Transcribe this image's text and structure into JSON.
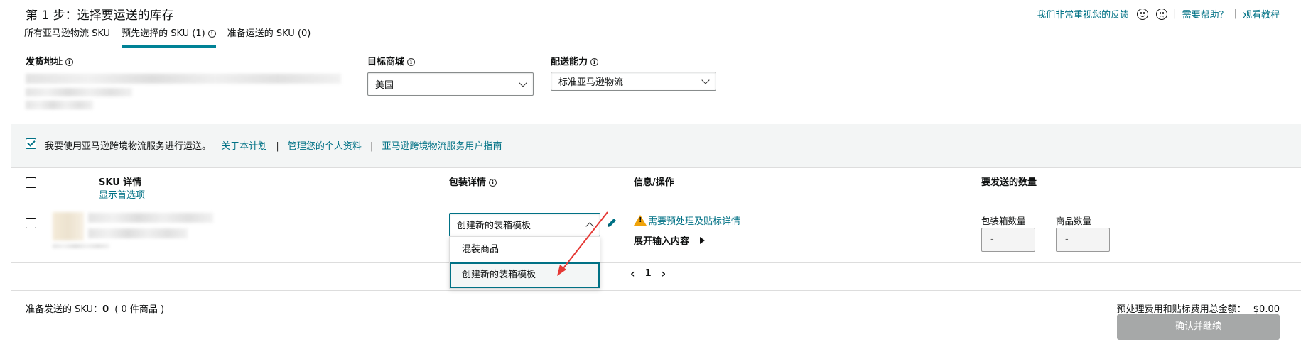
{
  "header": {
    "step_title": "第 1 步：选择要运送的库存",
    "feedback_link": "我们非常重视您的反馈",
    "help_link": "需要帮助？",
    "tutorial_link": "观看教程",
    "sep": "|"
  },
  "tabs": [
    {
      "label": "所有亚马逊物流 SKU",
      "active": false
    },
    {
      "label": "预先选择的 SKU (1)",
      "active": true
    },
    {
      "label": "准备运送的 SKU (0)",
      "active": false
    }
  ],
  "form": {
    "ship_from_label": "发货地址",
    "marketplace_label": "目标商城",
    "marketplace_value": "美国",
    "fulfillment_label": "配送能力",
    "fulfillment_value": "标准亚马逊物流"
  },
  "consent": {
    "text": "我要使用亚马逊跨境物流服务进行运送。",
    "checked": true,
    "links": [
      "关于本计划",
      "管理您的个人资料",
      "亚马逊跨境物流服务用户指南"
    ]
  },
  "table": {
    "headers": {
      "sku": "SKU 详情",
      "sku_sub": "显示首选项",
      "packing": "包装详情",
      "info": "信息/操作",
      "quantity": "要发送的数量"
    },
    "row": {
      "packing_value": "创建新的装箱模板",
      "warning_link": "需要预处理及贴标详情",
      "expand": "展开输入内容",
      "box_qty_label": "包装箱数量",
      "unit_qty_label": "商品数量",
      "box_qty": "-",
      "unit_qty": "-"
    },
    "dropdown_options": [
      "混装商品",
      "创建新的装箱模板"
    ],
    "pagination_page": "1"
  },
  "footer": {
    "ready_label": "准备发送的 SKU：",
    "ready_count": "0",
    "ready_items": "( 0 件商品 )",
    "fee_label": "预处理费用和贴标费用总金额：",
    "fee_value": "$0.00",
    "confirm_button": "确认并继续"
  },
  "colors": {
    "link": "#007185",
    "tab_active": "#008296",
    "warning": "#f0a30a",
    "button_disabled": "#a6a8a8",
    "arrow": "#e53935"
  }
}
